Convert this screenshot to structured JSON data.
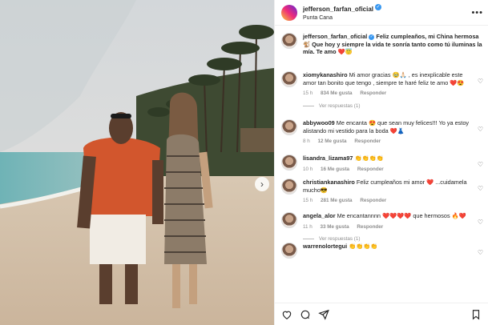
{
  "post": {
    "username": "jefferson_farfan_oficial",
    "location": "Punta Cana",
    "verified_mark": "✓"
  },
  "caption": {
    "username": "jefferson_farfan_oficial",
    "text": "Feliz cumpleaños, mi China hermosa 🐒 Que hoy y siempre la vida te sonría tanto como tú iluminas la mía. Te amo ❤️😇"
  },
  "comments": [
    {
      "username": "xiomykanashiro",
      "text": "Mi amor gracias 🥹🙏🏻 , es inexplicable este amor tan bonito que tengo , siempre te haré feliz te amo ❤️😍",
      "time": "15 h",
      "likes": "834 Me gusta",
      "reply_label": "Responder",
      "replies": "Ver respuestas (1)"
    },
    {
      "username": "abbywoo09",
      "text": "Me encanta 😍 que sean muy felices!!! Yo ya estoy alistando mi vestido para la boda ❤️👗",
      "time": "8 h",
      "likes": "12 Me gusta",
      "reply_label": "Responder",
      "replies": ""
    },
    {
      "username": "lisandra_lizama97",
      "text": "👏👏👏👏",
      "time": "10 h",
      "likes": "16 Me gusta",
      "reply_label": "Responder",
      "replies": ""
    },
    {
      "username": "christiankanashiro",
      "text": "Feliz cumpleaños mi amor ❤️ ...cuidamela mucho😎",
      "time": "15 h",
      "likes": "281 Me gusta",
      "reply_label": "Responder",
      "replies": ""
    },
    {
      "username": "angela_alor",
      "text": "Me encantannnn ❤️❤️❤️❤️ que hermosos 🔥❤️",
      "time": "11 h",
      "likes": "33 Me gusta",
      "reply_label": "Responder",
      "replies": "Ver respuestas (1)"
    },
    {
      "username": "warrenolortegui",
      "text": "👏👏👏👏",
      "time": "",
      "likes": "",
      "reply_label": "",
      "replies": ""
    }
  ],
  "icons": {
    "more": "more-options-icon",
    "like": "heart-icon",
    "comment": "comment-icon",
    "share": "send-icon",
    "save": "bookmark-icon",
    "next": "chevron-right-icon"
  },
  "colors": {
    "verified": "#3897f0",
    "text": "#262626",
    "muted": "#8e8e8e"
  }
}
